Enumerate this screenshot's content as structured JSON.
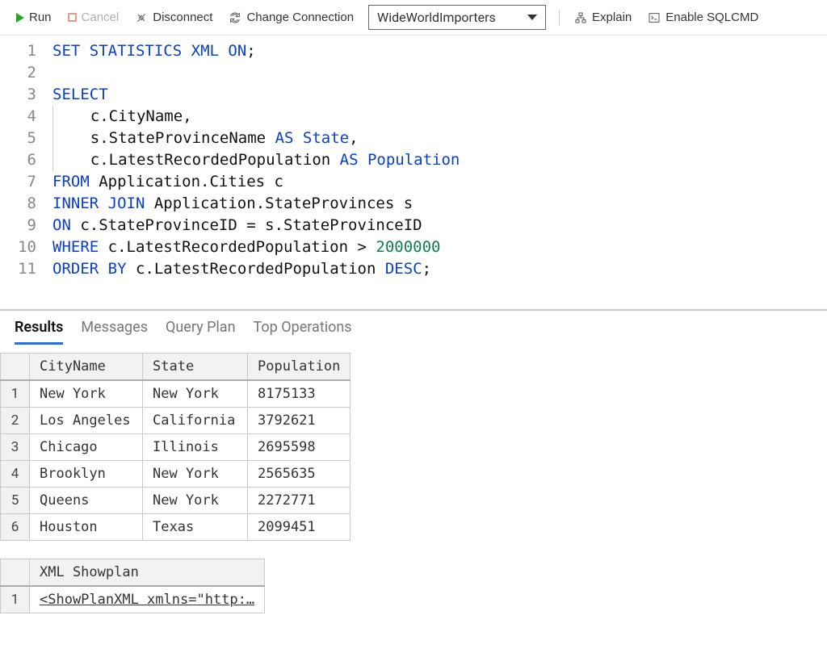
{
  "toolbar": {
    "run": "Run",
    "cancel": "Cancel",
    "disconnect": "Disconnect",
    "change_connection": "Change Connection",
    "connection": "WideWorldImporters",
    "explain": "Explain",
    "enable_sqlcmd": "Enable SQLCMD"
  },
  "editor": {
    "lines": [
      {
        "n": 1,
        "tokens": [
          [
            "kw",
            "SET"
          ],
          [
            "",
            " "
          ],
          [
            "kw",
            "STATISTICS"
          ],
          [
            "",
            " "
          ],
          [
            "kw",
            "XML"
          ],
          [
            "",
            " "
          ],
          [
            "kw",
            "ON"
          ],
          [
            "",
            ";"
          ]
        ]
      },
      {
        "n": 2,
        "tokens": []
      },
      {
        "n": 3,
        "tokens": [
          [
            "kw",
            "SELECT"
          ]
        ]
      },
      {
        "n": 4,
        "tokens": [
          [
            "indent",
            "    "
          ],
          [
            "",
            "c.CityName,"
          ]
        ]
      },
      {
        "n": 5,
        "tokens": [
          [
            "indent",
            "    "
          ],
          [
            "",
            "s.StateProvinceName "
          ],
          [
            "kw",
            "AS"
          ],
          [
            "",
            " "
          ],
          [
            "kw",
            "State"
          ],
          [
            "",
            ","
          ]
        ]
      },
      {
        "n": 6,
        "tokens": [
          [
            "indent",
            "    "
          ],
          [
            "",
            "c.LatestRecordedPopulation "
          ],
          [
            "kw",
            "AS"
          ],
          [
            "",
            " "
          ],
          [
            "kw",
            "Population"
          ]
        ]
      },
      {
        "n": 7,
        "tokens": [
          [
            "kw",
            "FROM"
          ],
          [
            "",
            " Application.Cities c"
          ]
        ]
      },
      {
        "n": 8,
        "tokens": [
          [
            "kw",
            "INNER"
          ],
          [
            "",
            " "
          ],
          [
            "kw",
            "JOIN"
          ],
          [
            "",
            " Application.StateProvinces s"
          ]
        ]
      },
      {
        "n": 9,
        "tokens": [
          [
            "kw",
            "ON"
          ],
          [
            "",
            " c.StateProvinceID = s.StateProvinceID"
          ]
        ]
      },
      {
        "n": 10,
        "tokens": [
          [
            "kw",
            "WHERE"
          ],
          [
            "",
            " c.LatestRecordedPopulation > "
          ],
          [
            "num",
            "2000000"
          ]
        ]
      },
      {
        "n": 11,
        "tokens": [
          [
            "kw",
            "ORDER"
          ],
          [
            "",
            " "
          ],
          [
            "kw",
            "BY"
          ],
          [
            "",
            " c.LatestRecordedPopulation "
          ],
          [
            "kw",
            "DESC"
          ],
          [
            "",
            ";"
          ]
        ]
      }
    ]
  },
  "tabs": {
    "results": "Results",
    "messages": "Messages",
    "query_plan": "Query Plan",
    "top_ops": "Top Operations"
  },
  "results": {
    "columns": [
      "CityName",
      "State",
      "Population"
    ],
    "rows": [
      [
        "New York",
        "New York",
        "8175133"
      ],
      [
        "Los Angeles",
        "California",
        "3792621"
      ],
      [
        "Chicago",
        "Illinois",
        "2695598"
      ],
      [
        "Brooklyn",
        "New York",
        "2565635"
      ],
      [
        "Queens",
        "New York",
        "2272771"
      ],
      [
        "Houston",
        "Texas",
        "2099451"
      ]
    ]
  },
  "showplan": {
    "header": "XML Showplan",
    "link": "<ShowPlanXML xmlns=\"http:…"
  }
}
